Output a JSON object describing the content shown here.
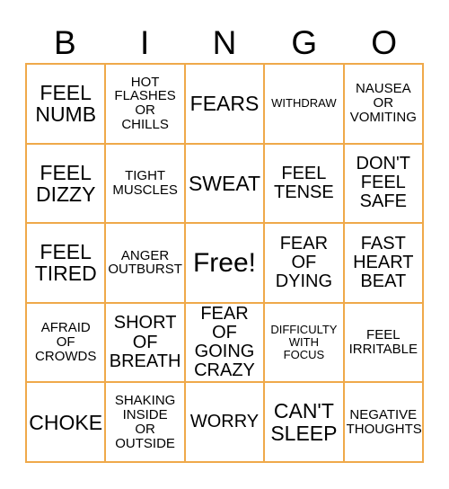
{
  "card": {
    "header_letters": [
      "B",
      "I",
      "N",
      "G",
      "O"
    ],
    "border_color": "#efa94a",
    "text_color": "#000000",
    "background_color": "#ffffff",
    "grid_size": "5x5",
    "cells": [
      {
        "text": "FEEL\nNUMB",
        "size": "fs-lg"
      },
      {
        "text": "HOT\nFLASHES\nOR\nCHILLS",
        "size": "fs-sm"
      },
      {
        "text": "FEARS",
        "size": "fs-lg"
      },
      {
        "text": "WITHDRAW",
        "size": "fs-xs"
      },
      {
        "text": "NAUSEA\nOR\nVOMITING",
        "size": "fs-sm"
      },
      {
        "text": "FEEL\nDIZZY",
        "size": "fs-lg"
      },
      {
        "text": "TIGHT\nMUSCLES",
        "size": "fs-sm"
      },
      {
        "text": "SWEAT",
        "size": "fs-lg"
      },
      {
        "text": "FEEL\nTENSE",
        "size": "fs-md"
      },
      {
        "text": "DON'T\nFEEL\nSAFE",
        "size": "fs-md"
      },
      {
        "text": "FEEL\nTIRED",
        "size": "fs-lg"
      },
      {
        "text": "ANGER\nOUTBURST",
        "size": "fs-sm"
      },
      {
        "text": "Free!",
        "size": "fs-free"
      },
      {
        "text": "FEAR\nOF\nDYING",
        "size": "fs-md"
      },
      {
        "text": "FAST\nHEART\nBEAT",
        "size": "fs-md"
      },
      {
        "text": "AFRAID\nOF\nCROWDS",
        "size": "fs-sm"
      },
      {
        "text": "SHORT\nOF\nBREATH",
        "size": "fs-md"
      },
      {
        "text": "FEAR OF\nGOING\nCRAZY",
        "size": "fs-md"
      },
      {
        "text": "DIFFICULTY\nWITH\nFOCUS",
        "size": "fs-xs"
      },
      {
        "text": "FEEL\nIRRITABLE",
        "size": "fs-sm"
      },
      {
        "text": "CHOKE",
        "size": "fs-lg"
      },
      {
        "text": "SHAKING\nINSIDE\nOR\nOUTSIDE",
        "size": "fs-sm"
      },
      {
        "text": "WORRY",
        "size": "fs-md"
      },
      {
        "text": "CAN'T\nSLEEP",
        "size": "fs-lg"
      },
      {
        "text": "NEGATIVE\nTHOUGHTS",
        "size": "fs-sm"
      }
    ]
  }
}
